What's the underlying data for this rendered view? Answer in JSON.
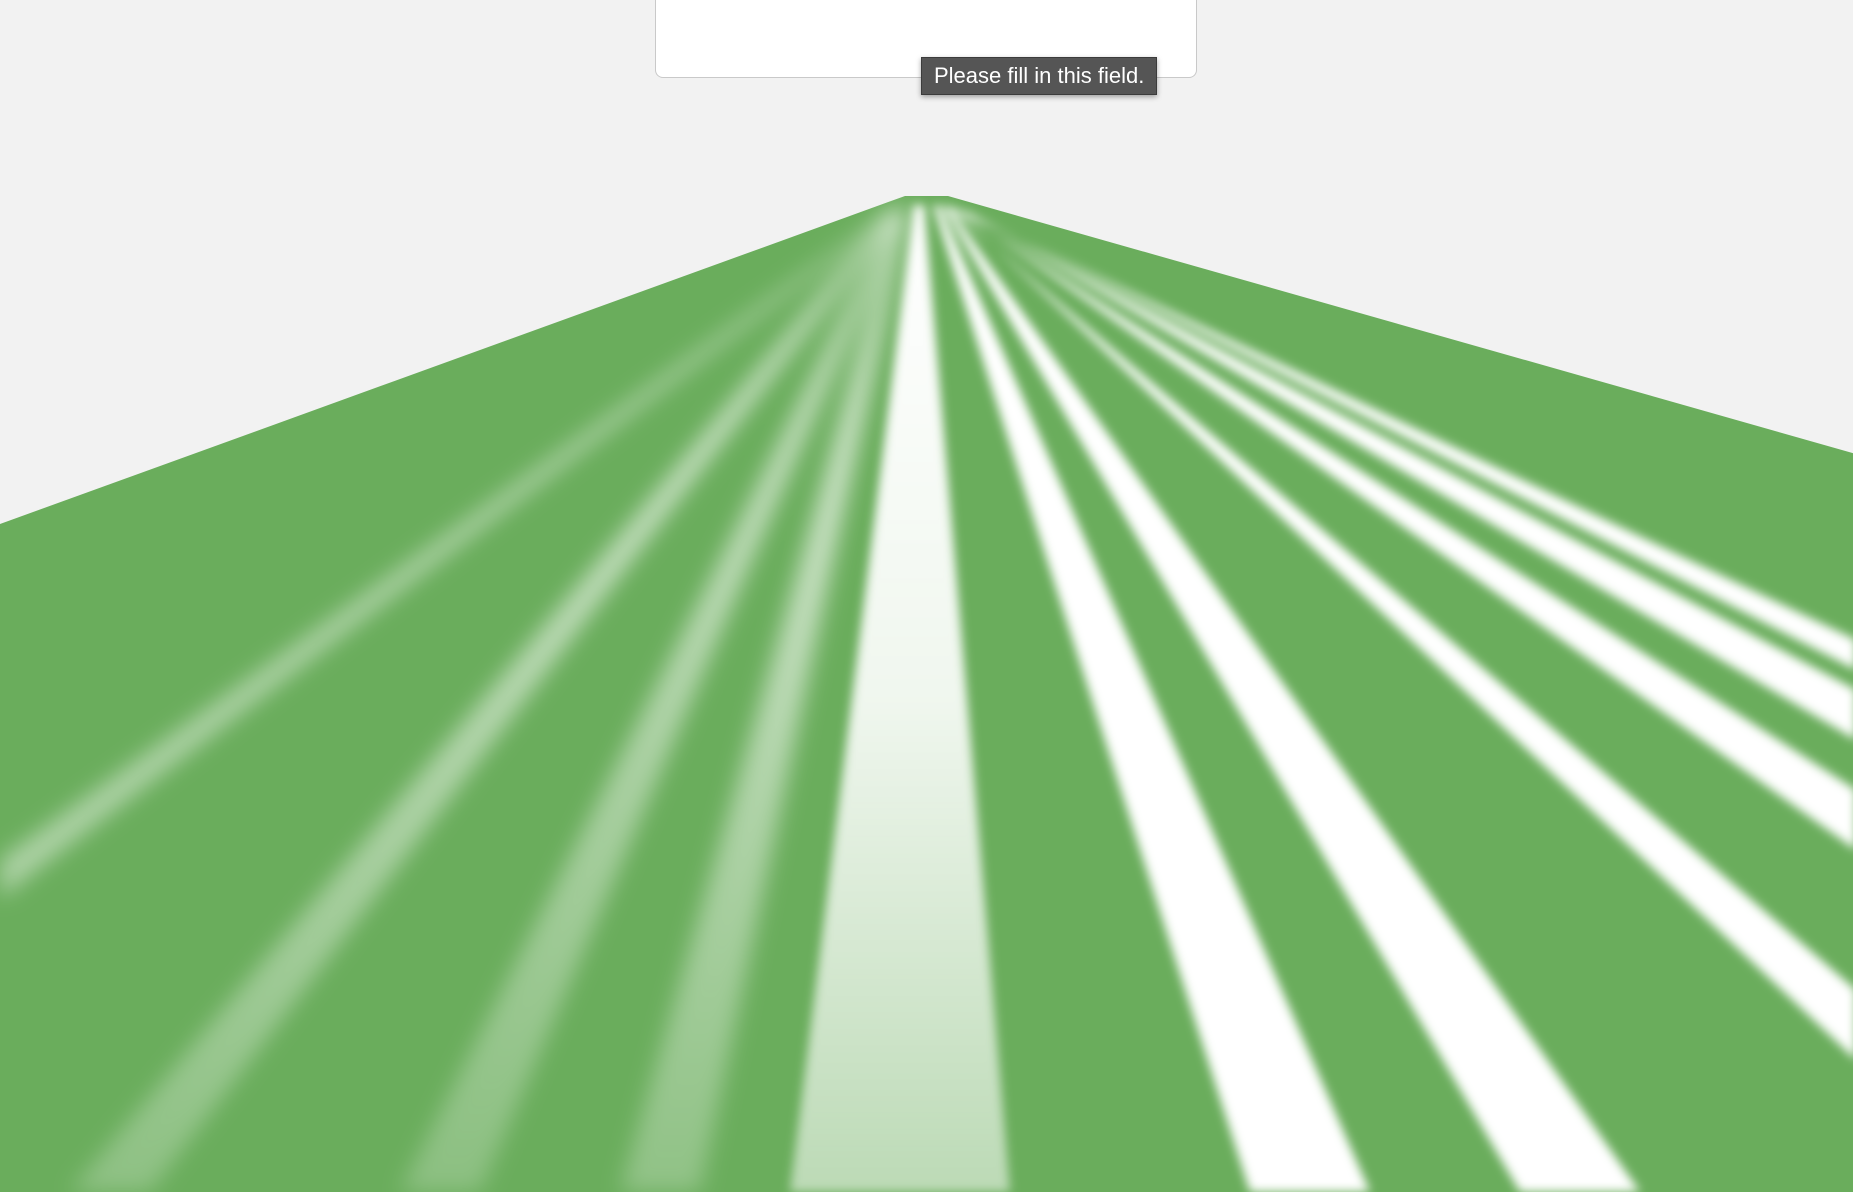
{
  "form": {
    "input_value": "",
    "input_placeholder": "",
    "validation_message": "Please fill in this field."
  },
  "scene": {
    "surface_color": "#6aad5c",
    "stripe_color": "#ffffff",
    "background_color": "#f2f2f2"
  }
}
